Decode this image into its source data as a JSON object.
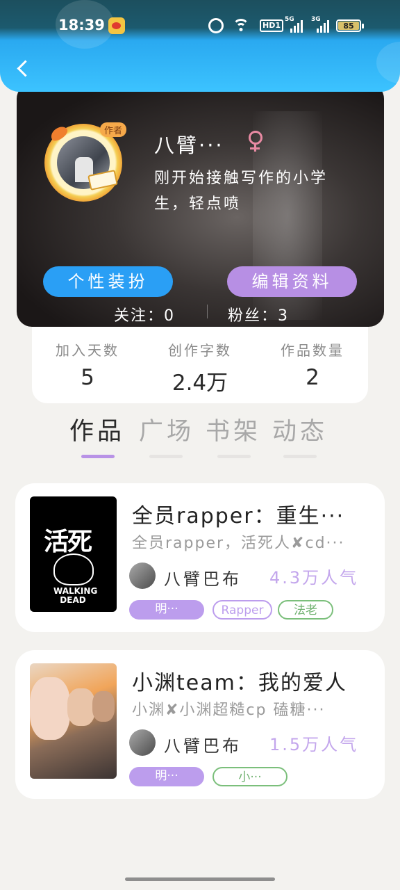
{
  "status_bar": {
    "time": "18:39",
    "hd_label": "HD1",
    "signal1_label": "5G",
    "signal2_label": "3G",
    "battery": "85"
  },
  "profile": {
    "badge": "作者",
    "name": "八臂···",
    "bio": "刚开始接触写作的小学生，轻点喷",
    "dress_button": "个性装扮",
    "edit_button": "编辑资料",
    "following": "关注：0",
    "fans": "粉丝：3"
  },
  "stats": [
    {
      "label": "加入天数",
      "value": "5"
    },
    {
      "label": "创作字数",
      "value": "2.4万"
    },
    {
      "label": "作品数量",
      "value": "2"
    }
  ],
  "tabs": [
    {
      "label": "作品",
      "active": true
    },
    {
      "label": "广场",
      "active": false
    },
    {
      "label": "书架",
      "active": false
    },
    {
      "label": "动态",
      "active": false
    }
  ],
  "works": [
    {
      "cover_text": "活死",
      "cover_subtext": "WALKING DEAD",
      "title": "全员rapper：重生···",
      "desc": "全员rapper，活死人✘cd···",
      "author": "八臂巴布",
      "popularity": "4.3万人气",
      "tags": [
        "明···",
        "Rapper",
        "法老"
      ]
    },
    {
      "title": "小渊team：我的爱人",
      "desc": "小渊✘小渊超糙cp 磕糖···",
      "author": "八臂巴布",
      "popularity": "1.5万人气",
      "tags": [
        "明···",
        "小···"
      ]
    }
  ],
  "colors": {
    "header_blue": "#2aa9f0",
    "accent_purple": "#b892e6",
    "button_blue": "#2a9ff5",
    "tag_green": "#7bbf7b"
  }
}
